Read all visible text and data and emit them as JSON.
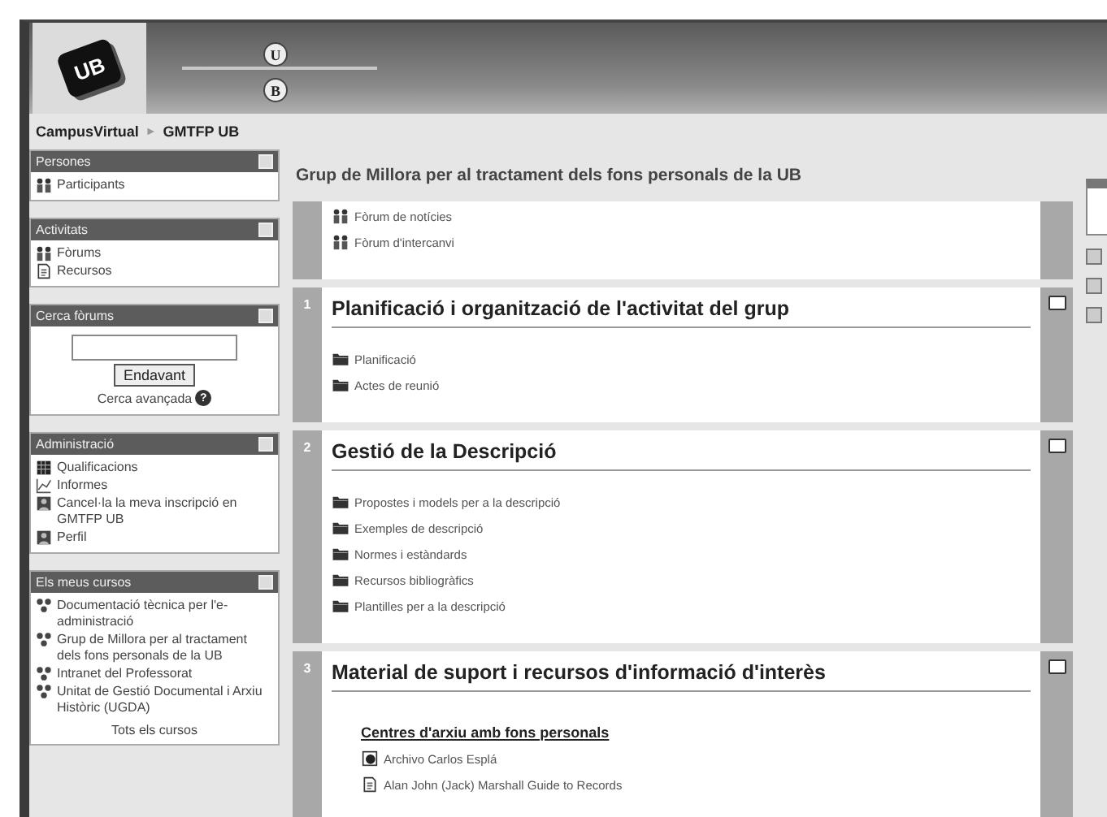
{
  "header": {
    "logo": "UB",
    "badges": [
      "U",
      "B"
    ]
  },
  "breadcrumb": {
    "items": [
      "CampusVirtual",
      "GMTFP UB"
    ],
    "separator": "►"
  },
  "sidebar": [
    {
      "title": "Persones",
      "kind": "list",
      "items": [
        {
          "label": "Participants",
          "kind": "people"
        }
      ]
    },
    {
      "title": "Activitats",
      "kind": "list",
      "items": [
        {
          "label": "Fòrums",
          "kind": "forum"
        },
        {
          "label": "Recursos",
          "kind": "page"
        }
      ]
    },
    {
      "title": "Cerca fòrums",
      "kind": "search",
      "button": "Endavant",
      "link": "Cerca avançada",
      "help": "?"
    },
    {
      "title": "Administració",
      "kind": "list",
      "items": [
        {
          "label": "Qualificacions",
          "kind": "grid"
        },
        {
          "label": "Informes",
          "kind": "chart"
        },
        {
          "label": "Cancel·la la meva inscripció en GMTFP UB",
          "kind": "person"
        },
        {
          "label": "Perfil",
          "kind": "person"
        }
      ]
    },
    {
      "title": "Els meus cursos",
      "kind": "list",
      "items": [
        {
          "label": "Documentació tècnica per l'e-administració",
          "kind": "course"
        },
        {
          "label": "Grup de Millora per al tractament dels fons personals de la UB",
          "kind": "course"
        },
        {
          "label": "Intranet del Professorat",
          "kind": "course"
        },
        {
          "label": "Unitat de Gestió Documental i Arxiu Històric (UGDA)",
          "kind": "course"
        }
      ],
      "footer": "Tots els cursos"
    }
  ],
  "course_title": "Grup de Millora per al tractament dels fons personals de la UB",
  "sections": [
    {
      "items": [
        {
          "kind": "forum",
          "label": "Fòrum de notícies"
        },
        {
          "kind": "forum",
          "label": "Fòrum d'intercanvi"
        }
      ]
    },
    {
      "number": "1",
      "title": "Planificació i organització de l'activitat del grup",
      "items": [
        {
          "kind": "folder",
          "label": "Planificació"
        },
        {
          "kind": "folder",
          "label": "Actes de reunió"
        }
      ]
    },
    {
      "number": "2",
      "title": "Gestió de la Descripció",
      "items": [
        {
          "kind": "folder",
          "label": "Propostes i models per a la descripció"
        },
        {
          "kind": "folder",
          "label": "Exemples de descripció"
        },
        {
          "kind": "folder",
          "label": "Normes i estàndards"
        },
        {
          "kind": "folder",
          "label": "Recursos bibliogràfics"
        },
        {
          "kind": "folder",
          "label": "Plantilles per a la descripció"
        }
      ]
    },
    {
      "number": "3",
      "title": "Material de suport i recursos d'informació d'interès",
      "items": [
        {
          "kind": "heading",
          "label": "Centres d'arxiu amb fons personals"
        },
        {
          "kind": "web",
          "label": "Archivo Carlos Esplá"
        },
        {
          "kind": "page",
          "label": "Alan John (Jack) Marshall Guide to Records"
        }
      ]
    }
  ]
}
